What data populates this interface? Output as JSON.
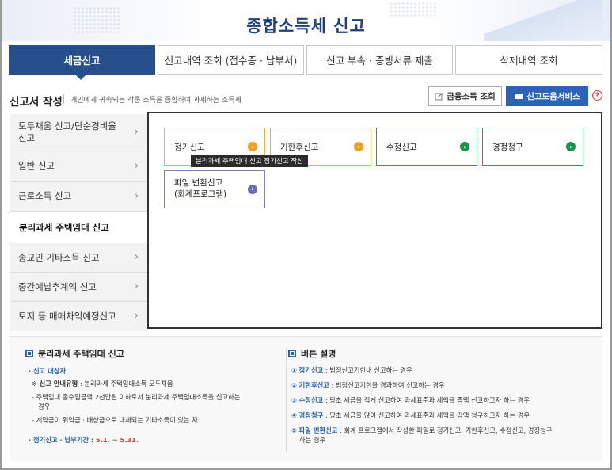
{
  "header": {
    "title": "종합소득세 신고"
  },
  "tabs": [
    {
      "label": "세금신고"
    },
    {
      "label": "신고내역 조회 (접수증 · 납부서)"
    },
    {
      "label": "신고 부속 · 증빙서류 제출"
    },
    {
      "label": "삭제내역 조회"
    }
  ],
  "section": {
    "title": "신고서 작성",
    "description": "개인에게 귀속되는 각종 소득을 종합하여 과세하는 소득세"
  },
  "actions": {
    "financial_label": "금융소득 조회",
    "help_label": "신고도움서비스",
    "question_glyph": "?"
  },
  "sidebar": {
    "items": [
      {
        "label": "모두채움 신고/단순경비율 신고"
      },
      {
        "label": "일반 신고"
      },
      {
        "label": "근로소득 신고"
      },
      {
        "label": "분리과세 주택임대 신고"
      },
      {
        "label": "종교인 기타소득 신고"
      },
      {
        "label": "중간예납추계액 신고"
      },
      {
        "label": "토지 등 매매차익예정신고"
      }
    ]
  },
  "options": [
    {
      "label": "정기신고",
      "color": "#f0a21a"
    },
    {
      "label": "기한후신고",
      "color": "#f0a21a"
    },
    {
      "label": "수정신고",
      "color": "#17944a"
    },
    {
      "label": "경정청구",
      "color": "#17944a"
    },
    {
      "label_line1": "파일 변환신고",
      "label_line2": "(회계프로그램)",
      "color": "#6a6fb3"
    }
  ],
  "tooltip": {
    "text": "분리과세 주택임대 신고 정기신고 작성"
  },
  "info_left": {
    "title": "분리과세 주택임대 신고",
    "target_label": "· 신고 대상자",
    "guide_prefix": "※",
    "guide_label": "신고 안내유형",
    "guide_text": ": 분리과세 주택임대소득 모두채움",
    "item1": "- 주택임대 총수입금액 2천만원 이하로서 분리과세 주택임대소득을 신고하는",
    "item1_cont": "경우",
    "item2": "- 계약금이 위약금 · 배상금으로 대체되는 기타소득이 있는 자",
    "period_label": "· 정기신고 · 납부기간 :",
    "period_value": "5.1. ~ 5.31."
  },
  "info_right": {
    "title": "버튼 설명",
    "lines": [
      {
        "num": "①",
        "name": "정기신고",
        "desc": ": 법정신고기한내 신고하는 경우"
      },
      {
        "num": "②",
        "name": "기한후신고",
        "desc": ": 법정신고기한을 경과하여 신고하는 경우"
      },
      {
        "num": "③",
        "name": "수정신고",
        "desc": ": 당초 세금을 적게 신고하여 과세표준과 세액을 증액 신고하고자 하는 경우"
      },
      {
        "num": "④",
        "name": "경정청구",
        "desc": ": 당초 세금을 많이 신고하여 과세표준과 세액을 감액 청구하고자 하는 경우"
      },
      {
        "num": "⑤",
        "name": "파일 변환신고",
        "desc": ": 회계 프로그램에서 작성한 파일로 정기신고, 기한후신고, 수정신고, 경정청구",
        "cont": "하는 경우"
      }
    ]
  }
}
